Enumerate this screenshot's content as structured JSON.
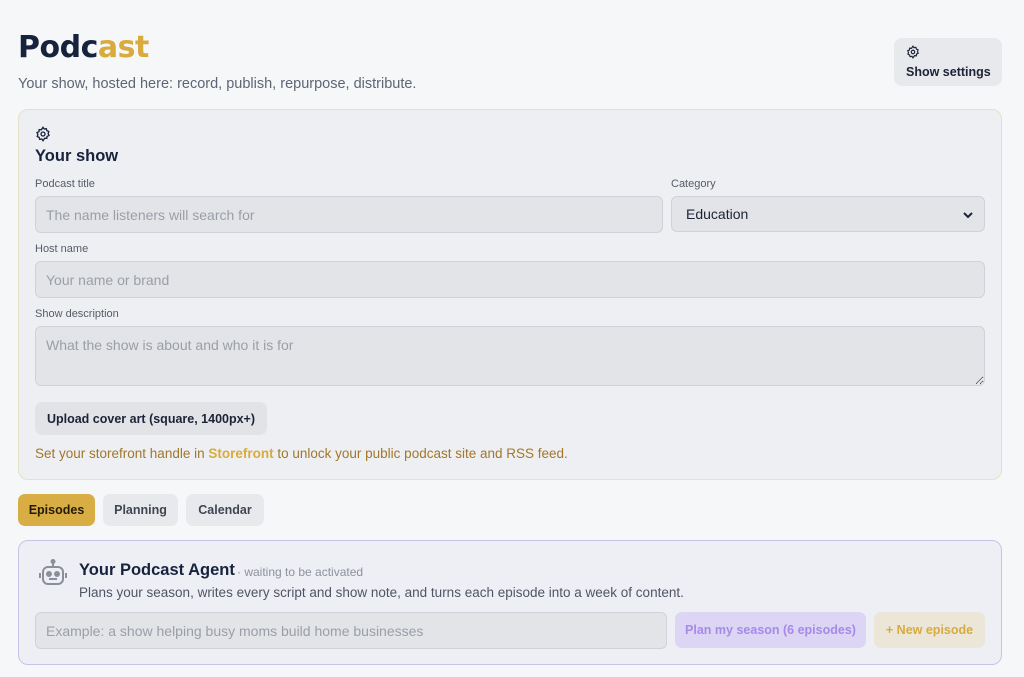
{
  "header": {
    "title_part1": "Podc",
    "title_part2": "ast",
    "subtitle": "Your show, hosted here: record, publish, repurpose, distribute.",
    "settings_label": "Show settings"
  },
  "show": {
    "heading": "Your show",
    "title_label": "Podcast title",
    "title_placeholder": "The name listeners will search for",
    "category_label": "Category",
    "category_value": "Education",
    "host_label": "Host name",
    "host_placeholder": "Your name or brand",
    "description_label": "Show description",
    "description_placeholder": "What the show is about and who it is for",
    "upload_label": "Upload cover art (square, 1400px+)",
    "note_before": "Set your storefront handle in ",
    "note_link": "Storefront",
    "note_after": " to unlock your public podcast site and RSS feed."
  },
  "tabs": [
    {
      "label": "Episodes",
      "active": true
    },
    {
      "label": "Planning",
      "active": false
    },
    {
      "label": "Calendar",
      "active": false
    }
  ],
  "agent": {
    "name": "Your Podcast Agent",
    "status": "· waiting to be activated",
    "description": "Plans your season, writes every script and show note, and turns each episode into a week of content.",
    "input_placeholder": "Example: a show helping busy moms build home businesses",
    "plan_label": "Plan my season (6 episodes)",
    "new_label": "+ New episode"
  },
  "colors": {
    "accent": "#d8ab3c",
    "agent_accent": "#a58ae8"
  },
  "icons": {
    "settings": "gear-icon",
    "show": "gear-icon",
    "agent": "robot-icon",
    "category_select": "chevron-down-icon"
  }
}
